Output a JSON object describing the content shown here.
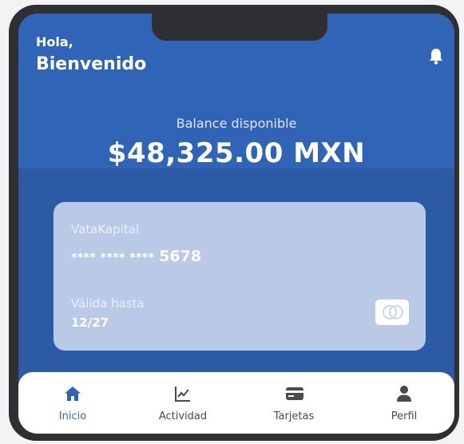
{
  "header": {
    "greeting": "Hola,",
    "welcome": "Bienvenido",
    "bell_icon": "bell-icon"
  },
  "balance": {
    "label": "Balance disponible",
    "amount": "$48,325.00 MXN"
  },
  "card": {
    "brand": "VataKapital",
    "number_mask": "**** **** ****",
    "number_last": "5678",
    "valid_label": "Válida hasta",
    "valid_date": "12/27",
    "logo_icon": "mastercard-icon"
  },
  "nav": {
    "items": [
      {
        "label": "Inicio",
        "icon": "home-icon",
        "active": true
      },
      {
        "label": "Actividad",
        "icon": "chart-icon",
        "active": false
      },
      {
        "label": "Tarjetas",
        "icon": "card-icon",
        "active": false
      },
      {
        "label": "Perfil",
        "icon": "user-icon",
        "active": false
      }
    ]
  },
  "colors": {
    "primary": "#2f64b7",
    "background_band": "#2d5aa5",
    "card": "#b9c9e6",
    "nav_active": "#2f64b7",
    "nav_inactive": "#4a4a4a"
  }
}
